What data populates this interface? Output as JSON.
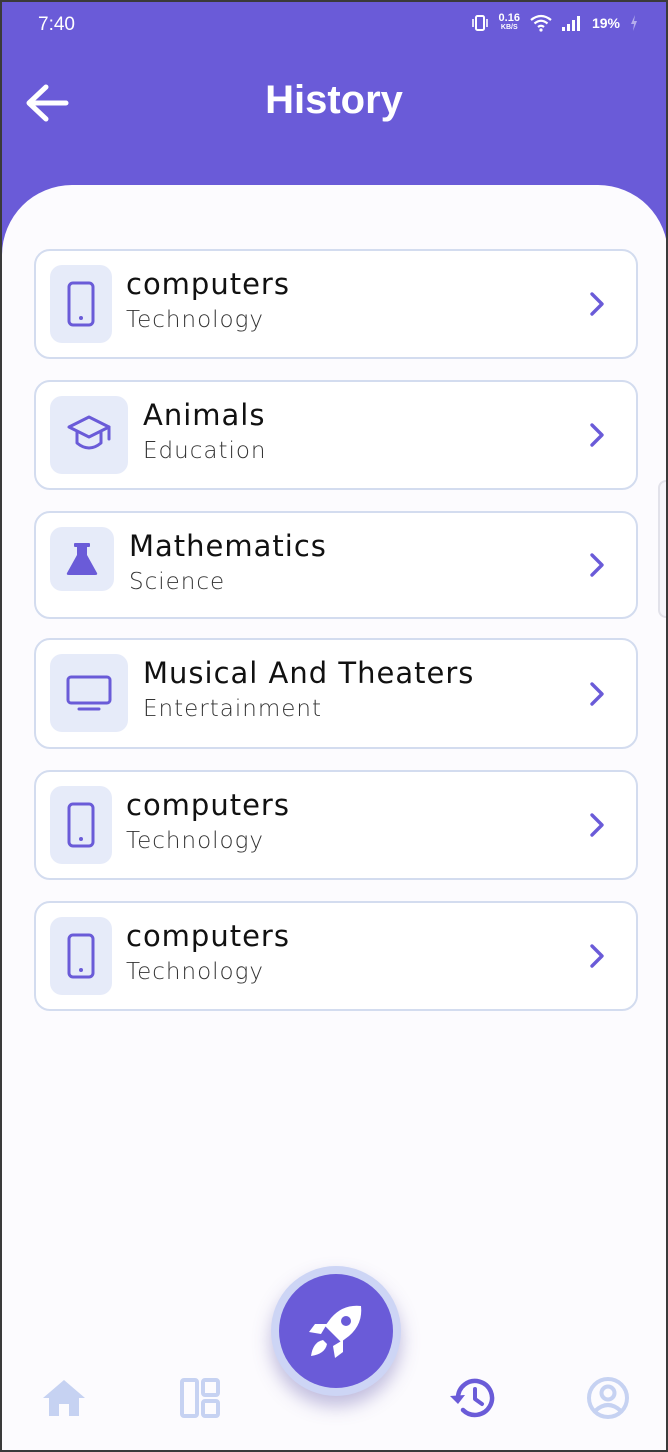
{
  "status_bar": {
    "time": "7:40",
    "net_speed_value": "0.16",
    "net_speed_unit": "KB/S",
    "battery": "19%"
  },
  "header": {
    "title": "History",
    "back_icon": "arrow-left-icon"
  },
  "history_items": [
    {
      "title": "computers",
      "category": "Technology",
      "icon": "phone-icon"
    },
    {
      "title": "Animals",
      "category": "Education",
      "icon": "graduation-cap-icon"
    },
    {
      "title": "Mathematics",
      "category": "Science",
      "icon": "flask-icon"
    },
    {
      "title": "Musical And Theaters",
      "category": "Entertainment",
      "icon": "tv-icon"
    },
    {
      "title": "computers",
      "category": "Technology",
      "icon": "phone-icon"
    },
    {
      "title": "computers",
      "category": "Technology",
      "icon": "phone-icon"
    }
  ],
  "bottom_nav": {
    "items": [
      "home-icon",
      "dashboard-icon",
      "rocket-icon",
      "history-icon",
      "profile-icon"
    ],
    "active": "history-icon"
  },
  "colors": {
    "primary": "#6a5bd8",
    "icon_bg": "#e6ebf9",
    "inactive_nav": "#c6d2f2",
    "card_border": "#d3dcef"
  }
}
